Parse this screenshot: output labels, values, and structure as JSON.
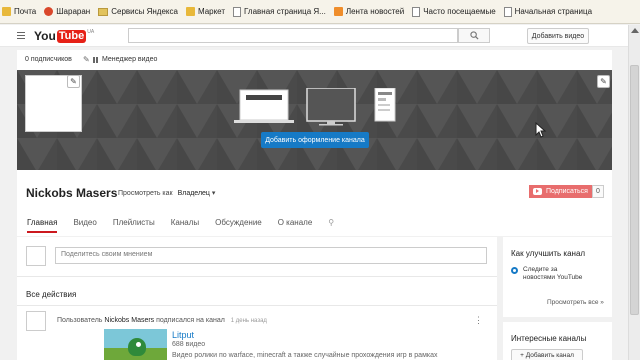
{
  "bookmarks": [
    {
      "label": "Почта",
      "icon": "yandex-mail-icon",
      "type": "y"
    },
    {
      "label": "Шараран",
      "icon": "site-icon",
      "type": "red"
    },
    {
      "label": "Сервисы Яндекса",
      "icon": "folder-icon",
      "type": "folder"
    },
    {
      "label": "Маркет",
      "icon": "market-icon",
      "type": "y"
    },
    {
      "label": "Главная страница Я...",
      "icon": "page-icon",
      "type": "page"
    },
    {
      "label": "Лента новостей",
      "icon": "rss-icon",
      "type": "rss"
    },
    {
      "label": "Часто посещаемые",
      "icon": "page-icon",
      "type": "page"
    },
    {
      "label": "Начальная страница",
      "icon": "page-icon",
      "type": "page"
    }
  ],
  "header": {
    "logo_you": "You",
    "logo_tube": "Tube",
    "logo_region": "UA",
    "search_placeholder": "",
    "upload_label": "Добавить видео"
  },
  "channel_top": {
    "subscribers": "0 подписчиков",
    "video_manager": "Менеджер видео"
  },
  "banner": {
    "add_art_label": "Добавить оформление канала",
    "background_color": "#4e4e4e",
    "button_color": "#167ac6"
  },
  "channel": {
    "name": "Nickobs Masers",
    "view_as_label": "Просмотреть как",
    "view_as_value": "Владелец",
    "subscribe_label": "Подписаться",
    "subscribe_count": "0",
    "subscribe_color": "#e86d6d"
  },
  "tabs": [
    {
      "label": "Главная",
      "active": true
    },
    {
      "label": "Видео",
      "active": false
    },
    {
      "label": "Плейлисты",
      "active": false
    },
    {
      "label": "Каналы",
      "active": false
    },
    {
      "label": "Обсуждение",
      "active": false
    },
    {
      "label": "О канале",
      "active": false
    }
  ],
  "feed": {
    "comment_placeholder": "Поделитесь своим мнением",
    "actions_title": "Все действия",
    "activity_prefix": "Пользователь",
    "activity_user": "Nickobs Masers",
    "activity_action": "подписался на канал",
    "activity_time": "1 день назад",
    "video_title": "Litput",
    "video_count": "688 видео",
    "video_desc": "Видео ролики по warface, minecraft а также случайные прохождения игр в рамках"
  },
  "sidebar": {
    "improve_title": "Как улучшить канал",
    "improve_item": "Следите за новостями YouTube",
    "improve_more": "Просмотреть все »",
    "interesting_title": "Интересные каналы",
    "add_channel": "+ Добавить канал"
  }
}
